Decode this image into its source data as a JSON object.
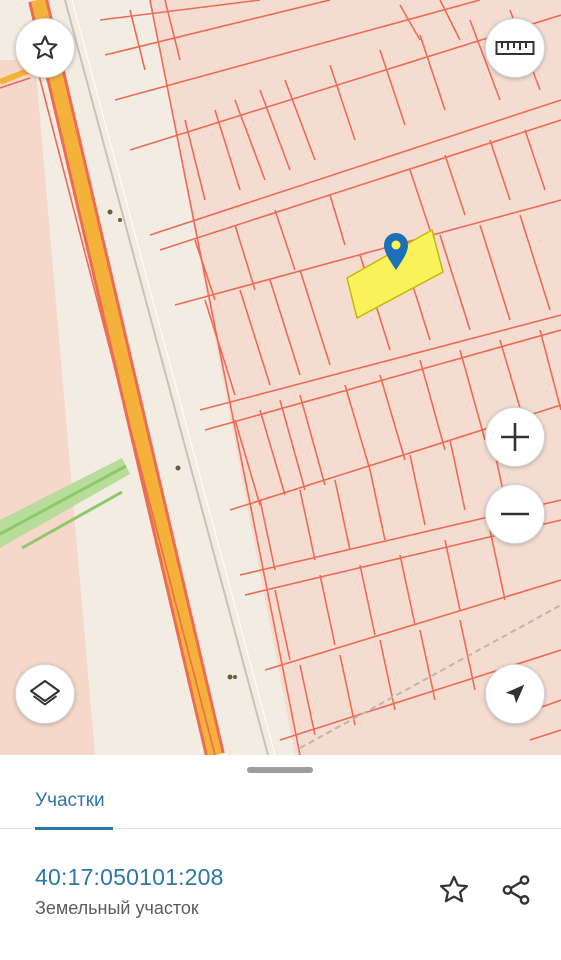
{
  "map": {
    "controls": {
      "favorite_icon": "star-outline-icon",
      "ruler_icon": "ruler-icon",
      "zoom_in_icon": "plus-icon",
      "zoom_out_icon": "minus-icon",
      "layers_icon": "layers-icon",
      "locate_icon": "navigation-arrow-icon"
    },
    "colors": {
      "background": "#f2ece2",
      "parcel_border": "#ee6b55",
      "road_orange": "#f5b23a",
      "selected_parcel": "#f9f25a",
      "pin": "#1d6fb8"
    }
  },
  "sheet": {
    "tabs": [
      {
        "label": "Участки",
        "active": true
      }
    ],
    "parcel": {
      "cadastral_number": "40:17:050101:208",
      "type": "Земельный участок"
    },
    "actions": {
      "favorite_icon": "star-outline-icon",
      "share_icon": "share-icon"
    },
    "accent_color": "#2b78a8"
  }
}
